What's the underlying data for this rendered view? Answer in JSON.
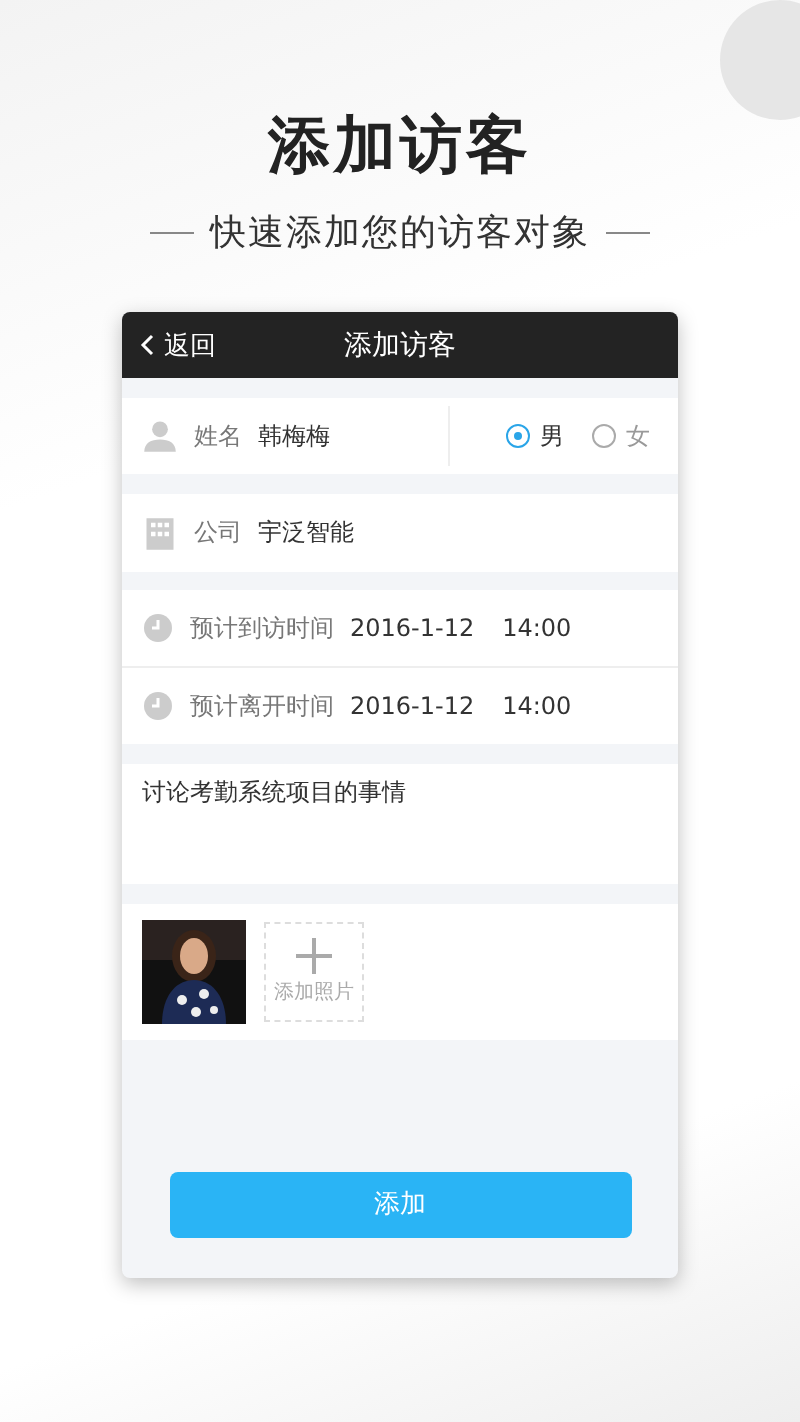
{
  "headline": {
    "title": "添加访客",
    "subtitle": "快速添加您的访客对象"
  },
  "nav": {
    "back": "返回",
    "title": "添加访客"
  },
  "name_row": {
    "label": "姓名",
    "value": "韩梅梅",
    "genders": [
      {
        "label": "男",
        "selected": true
      },
      {
        "label": "女",
        "selected": false
      }
    ]
  },
  "company_row": {
    "label": "公司",
    "value": "宇泛智能"
  },
  "time_rows": [
    {
      "label": "预计到访时间",
      "date": "2016-1-12",
      "time": "14:00"
    },
    {
      "label": "预计离开时间",
      "date": "2016-1-12",
      "time": "14:00"
    }
  ],
  "note": {
    "value": "讨论考勤系统项目的事情"
  },
  "photos": {
    "add_label": "添加照片"
  },
  "submit": "添加"
}
